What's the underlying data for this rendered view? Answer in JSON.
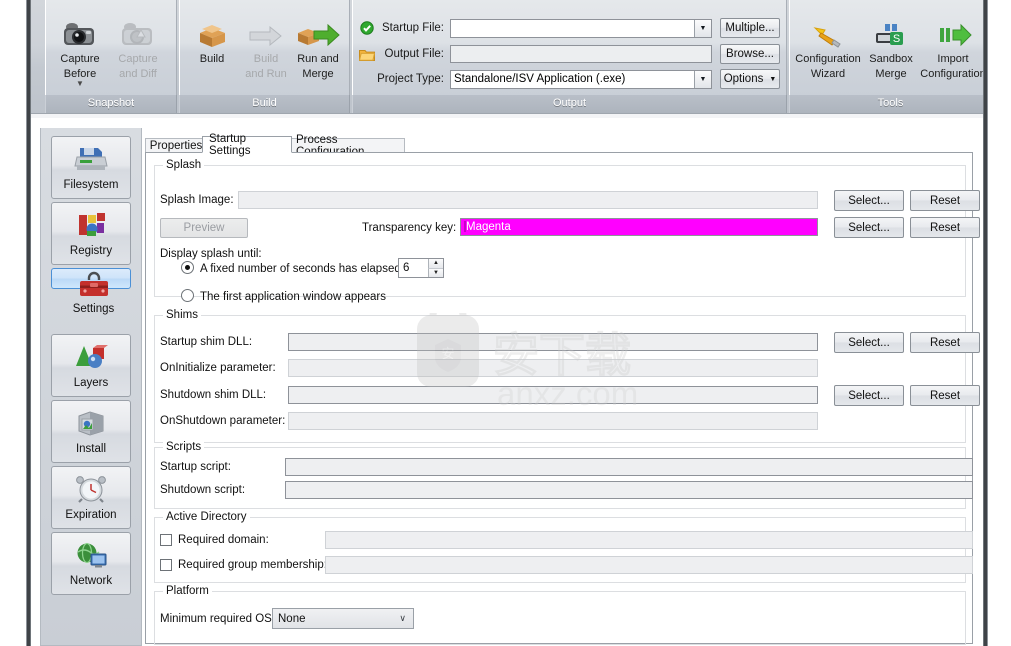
{
  "ribbon": {
    "groups": [
      {
        "name": "Snapshot",
        "caption": "Snapshot",
        "buttons": [
          {
            "label_lines": [
              "Capture",
              "Before"
            ],
            "icon": "camera-icon",
            "enabled": true,
            "has_dropdown": true
          },
          {
            "label_lines": [
              "Capture",
              "and Diff"
            ],
            "icon": "camera-diff-icon",
            "enabled": false,
            "has_dropdown": false
          }
        ]
      },
      {
        "name": "Build",
        "caption": "Build",
        "buttons": [
          {
            "label_lines": [
              "Build"
            ],
            "icon": "box-icon",
            "enabled": true,
            "has_dropdown": false
          },
          {
            "label_lines": [
              "Build",
              "and Run"
            ],
            "icon": "arrow-grey-icon",
            "enabled": false,
            "has_dropdown": false
          },
          {
            "label_lines": [
              "Run and",
              "Merge"
            ],
            "icon": "box-arrow-green-icon",
            "enabled": true,
            "has_dropdown": false
          }
        ]
      },
      {
        "name": "Output",
        "caption": "Output",
        "rows": [
          {
            "icon": "green-check-icon",
            "label": "Startup File:",
            "value": "",
            "kind": "combo",
            "button": "Multiple...",
            "button_dropdown": false
          },
          {
            "icon": "folder-icon",
            "label": "Output File:",
            "value": "",
            "kind": "readonly",
            "button": "Browse...",
            "button_dropdown": false
          },
          {
            "icon": "",
            "label": "Project Type:",
            "value": "Standalone/ISV Application (.exe)",
            "kind": "combo",
            "button": "Options",
            "button_dropdown": true
          }
        ]
      },
      {
        "name": "Tools",
        "caption": "Tools",
        "buttons": [
          {
            "label_lines": [
              "Configuration",
              "Wizard"
            ],
            "icon": "wand-icon",
            "enabled": true,
            "has_dropdown": false
          },
          {
            "label_lines": [
              "Sandbox",
              "Merge"
            ],
            "icon": "sandbox-merge-icon",
            "enabled": true,
            "has_dropdown": false
          },
          {
            "label_lines": [
              "Import",
              "Configuration"
            ],
            "icon": "import-config-icon",
            "enabled": true,
            "has_dropdown": false
          }
        ]
      }
    ],
    "overflow_arrow": "▶"
  },
  "sidebar": {
    "items": [
      {
        "label": "Filesystem",
        "icon": "floppy-drive-icon",
        "selected": false
      },
      {
        "label": "Registry",
        "icon": "registry-blocks-icon",
        "selected": false
      },
      {
        "label": "Settings",
        "icon": "toolbox-icon",
        "selected": true
      },
      {
        "label": "Layers",
        "icon": "shapes-layers-icon",
        "selected": false
      },
      {
        "label": "Install",
        "icon": "install-books-icon",
        "selected": false
      },
      {
        "label": "Expiration",
        "icon": "alarm-clock-icon",
        "selected": false
      },
      {
        "label": "Network",
        "icon": "globe-monitor-icon",
        "selected": false
      }
    ]
  },
  "tabs": [
    {
      "label": "Properties",
      "active": false
    },
    {
      "label": "Startup Settings",
      "active": true
    },
    {
      "label": "Process Configuration",
      "active": false
    }
  ],
  "watermark": {
    "text": "anxz.com",
    "glyphs": "安下载"
  },
  "panel": {
    "splash": {
      "caption": "Splash",
      "image_label": "Splash Image:",
      "image_value": "",
      "preview_button": "Preview",
      "transparency_label": "Transparency key:",
      "transparency_value": "Magenta",
      "transparency_color": "#ff00ff",
      "select_button": "Select...",
      "reset_button": "Reset",
      "display_until_label": "Display splash until:",
      "radio_fixed": "A fixed number of seconds has elapsed:",
      "seconds_value": "6",
      "radio_first_window": "The first application window appears"
    },
    "shims": {
      "caption": "Shims",
      "rows": [
        {
          "label": "Startup shim DLL:",
          "value": "",
          "readonly": false,
          "has_buttons": true
        },
        {
          "label": "OnInitialize parameter:",
          "value": "",
          "readonly": true,
          "has_buttons": false
        },
        {
          "label": "Shutdown shim DLL:",
          "value": "",
          "readonly": false,
          "has_buttons": true
        },
        {
          "label": "OnShutdown parameter:",
          "value": "",
          "readonly": true,
          "has_buttons": false
        }
      ],
      "select_button": "Select...",
      "reset_button": "Reset"
    },
    "scripts": {
      "caption": "Scripts",
      "rows": [
        {
          "label": "Startup script:",
          "value": ""
        },
        {
          "label": "Shutdown script:",
          "value": ""
        }
      ]
    },
    "active_directory": {
      "caption": "Active Directory",
      "rows": [
        {
          "label": "Required domain:",
          "value": "",
          "checked": false
        },
        {
          "label": "Required group membership:",
          "value": "",
          "checked": false
        }
      ]
    },
    "platform": {
      "caption": "Platform",
      "label": "Minimum required OS:",
      "value": "None",
      "chevron": "∨"
    }
  }
}
